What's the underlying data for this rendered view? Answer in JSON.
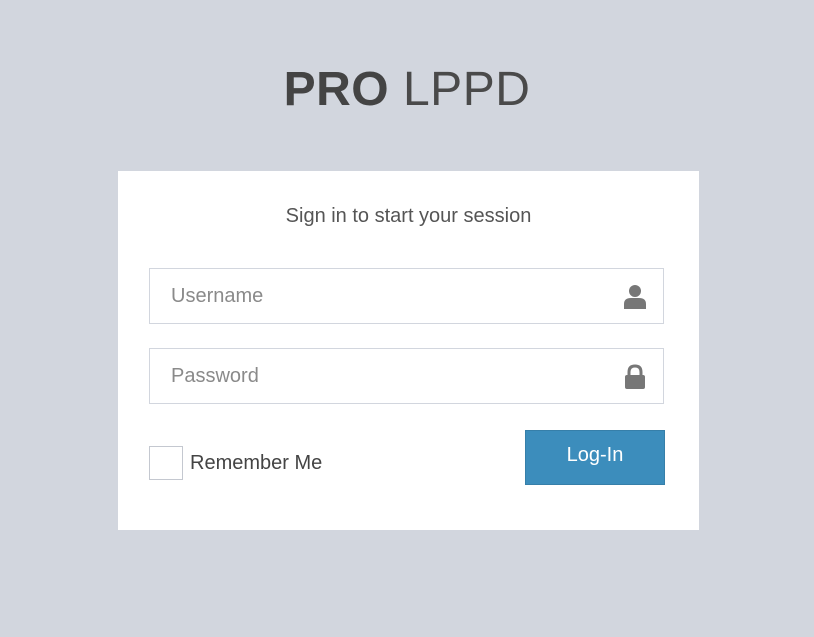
{
  "logo": {
    "bold_text": "PRO",
    "light_text": "LPPD"
  },
  "login_box": {
    "message": "Sign in to start your session",
    "username": {
      "placeholder": "Username",
      "value": "",
      "icon": "user-icon"
    },
    "password": {
      "placeholder": "Password",
      "value": "",
      "icon": "lock-icon"
    },
    "remember_label": "Remember Me",
    "remember_checked": false,
    "submit_label": "Log-In"
  },
  "colors": {
    "background": "#d2d6de",
    "card": "#ffffff",
    "accent": "#3c8dbc",
    "icon": "#777777"
  }
}
